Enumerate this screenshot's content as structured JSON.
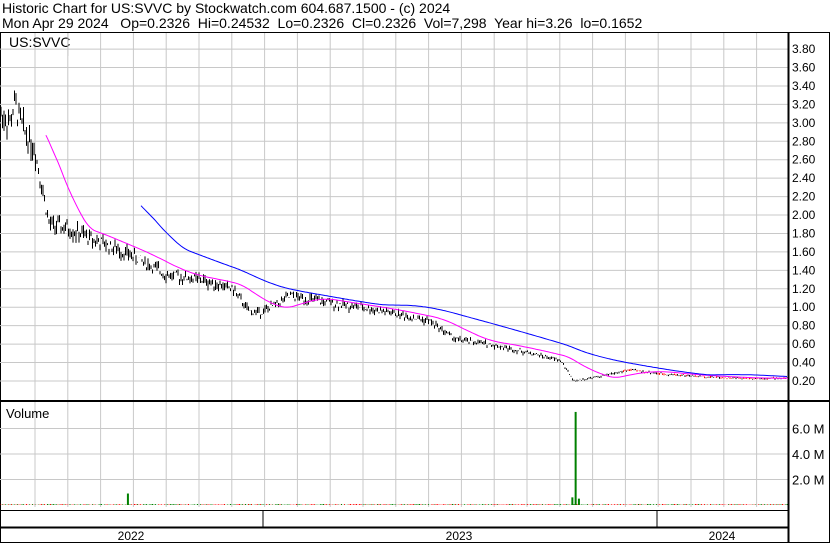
{
  "header": {
    "line1": "Historic Chart for US:SVVC by Stockwatch.com 604.687.1500 - (c) 2024",
    "line2": "Mon Apr 29 2024   Op=0.2326  Hi=0.24532  Lo=0.2326  Cl=0.2326  Vol=7,298  Year hi=3.26  lo=0.1652"
  },
  "chart_data": {
    "type": "line",
    "symbol_label": "US:SVVC",
    "volume_label": "Volume",
    "price_ticks": [
      "0.20",
      "0.40",
      "0.60",
      "0.80",
      "1.00",
      "1.20",
      "1.40",
      "1.60",
      "1.80",
      "2.00",
      "2.20",
      "2.40",
      "2.60",
      "2.80",
      "3.00",
      "3.20",
      "3.40",
      "3.60",
      "3.80"
    ],
    "ylim": [
      0.2,
      3.8
    ],
    "volume_ticks": [
      "2.0 M",
      "4.0 M",
      "6.0 M"
    ],
    "volume_ylim_millions": [
      0,
      8
    ],
    "x_labels": [
      "2022",
      "2023",
      "2024"
    ],
    "x_unit": "months since May 2022",
    "price_series": [
      [
        0,
        3.1
      ],
      [
        0.3,
        3.0
      ],
      [
        0.45,
        3.2
      ],
      [
        0.7,
        2.95
      ],
      [
        1.07,
        2.7
      ],
      [
        1.5,
        1.9
      ],
      [
        2.07,
        1.85
      ],
      [
        3.08,
        1.7
      ],
      [
        4.08,
        1.55
      ],
      [
        5.1,
        1.35
      ],
      [
        6.1,
        1.3
      ],
      [
        7.1,
        1.2
      ],
      [
        7.6,
        0.95
      ],
      [
        8.0,
        0.95
      ],
      [
        8.85,
        1.12
      ],
      [
        10.0,
        1.05
      ],
      [
        11.0,
        1.0
      ],
      [
        12.2,
        0.92
      ],
      [
        13.1,
        0.85
      ],
      [
        13.9,
        0.65
      ],
      [
        14.9,
        0.6
      ],
      [
        16.2,
        0.5
      ],
      [
        17.1,
        0.42
      ],
      [
        17.5,
        0.2
      ],
      [
        18.3,
        0.25
      ],
      [
        19.2,
        0.32
      ],
      [
        20.1,
        0.28
      ],
      [
        21.3,
        0.25
      ],
      [
        22.6,
        0.23
      ],
      [
        24.0,
        0.23
      ]
    ],
    "volume_spikes_millions": [
      [
        3.9,
        0.9
      ],
      [
        17.45,
        0.6
      ],
      [
        17.55,
        7.3
      ],
      [
        17.65,
        0.5
      ]
    ],
    "moving_averages": [
      {
        "name": "short MA",
        "color": "#ff00ff",
        "window_months": 1.4
      },
      {
        "name": "long MA",
        "color": "#0000ff",
        "window_months": 4.3
      }
    ],
    "colors": {
      "up": "#008000",
      "down": "#ff0000",
      "grid": "#c8c8c8"
    }
  }
}
